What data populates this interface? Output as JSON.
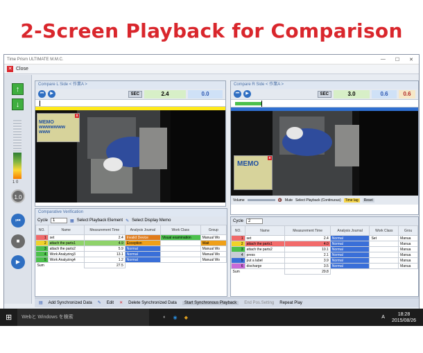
{
  "headline": "2-Screen Playback for Comparison",
  "window": {
    "title": "Time Prism ULTIMATE M.M.C.",
    "close_label": "Close"
  },
  "left_toolbar": {
    "level_label": "1 0",
    "speed_label": "1.0"
  },
  "left_panel": {
    "title": "Compare L Side  < 作業A >",
    "sec_label": "SEC",
    "time_value": "2.4",
    "diff_value": "0.0",
    "memo_text": "MEMO\nwwwwwww\nwww"
  },
  "right_panel": {
    "title": "Compare R Side  < 作業A >",
    "sec_label": "SEC",
    "time_value": "3.0",
    "diff_value": "0.6",
    "diff_value2": "0.6",
    "memo_text": "MEMO",
    "volume_label": "Volume",
    "mute_label": "Mute",
    "select_playback_label": "Select Playback (Continuous)",
    "time_lag_label": "Time lag",
    "reset_label": "Reset"
  },
  "comparative": {
    "title": "Comparative Verification",
    "cycle_label": "Cycle",
    "left_cycle_value": "1",
    "right_cycle_value": "2",
    "select_element_label": "Select Playback Element",
    "select_memo_label": "Select Display Memo",
    "left_columns": [
      "NO.",
      "Name",
      "Measurement Time",
      "Analysis Journal",
      "Work Class",
      "Group"
    ],
    "right_columns": [
      "NO.",
      "Name",
      "Measurement Time",
      "Analysis Journal",
      "Work Class",
      "Grou"
    ],
    "left_rows": [
      {
        "no": "1",
        "name": "set",
        "time": "2.4",
        "journal": "Invalid Device",
        "class": "Visual examination",
        "group": "Manual Wo"
      },
      {
        "no": "2",
        "name": "attach the parts1",
        "time": "4.9",
        "journal": "Exception",
        "class": "",
        "group": "Wait"
      },
      {
        "no": "3",
        "name": "attach the parts2",
        "time": "5.9",
        "journal": "Normal",
        "class": "",
        "group": "Manual Wo"
      },
      {
        "no": "4",
        "name": "Work Analyzing3",
        "time": "13.1",
        "journal": "Normal",
        "class": "",
        "group": "Manual Wo"
      },
      {
        "no": "5",
        "name": "Work Analyzing4",
        "time": "1.2",
        "journal": "Normal",
        "class": "",
        "group": "Manual Wo"
      }
    ],
    "right_rows": [
      {
        "no": "1",
        "name": "set",
        "time": "2.4",
        "journal": "Normal",
        "class": "Set",
        "group": "Manua"
      },
      {
        "no": "2",
        "name": "attach the parts1",
        "time": "4.0",
        "journal": "Normal",
        "class": "",
        "group": "Manua"
      },
      {
        "no": "3",
        "name": "attach the parts2",
        "time": "10.1",
        "journal": "Normal",
        "class": "",
        "group": "Manua"
      },
      {
        "no": "4",
        "name": "press",
        "time": "2.1",
        "journal": "Normal",
        "class": "",
        "group": "Manua"
      },
      {
        "no": "5",
        "name": "put a label",
        "time": "3.9",
        "journal": "Normal",
        "class": "",
        "group": "Manua"
      },
      {
        "no": "6",
        "name": "discharge",
        "time": "3.5",
        "journal": "Normal",
        "class": "",
        "group": "Manua"
      }
    ],
    "sum_label": "Sum",
    "left_sum": "27.5",
    "right_sum": "29.8"
  },
  "bottom_toolbar": {
    "add_label": "Add Synchronized Data",
    "edit_label": "Edit",
    "delete_label": "Delete Synchronized Data",
    "start_label": "Start Synchronous Playback",
    "end_label": "End Pos.Setting",
    "repeat_label": "Repeat Play"
  },
  "taskbar": {
    "search_text": "Webと Windows を検索",
    "ime_label": "A",
    "clock_time": "18:28",
    "clock_date": "2015/08/26"
  },
  "colors": {
    "accent_red": "#d9262c",
    "normal_blue": "#3a6fd8",
    "exception_orange": "#f0a018",
    "green_row": "#8fd36a"
  }
}
